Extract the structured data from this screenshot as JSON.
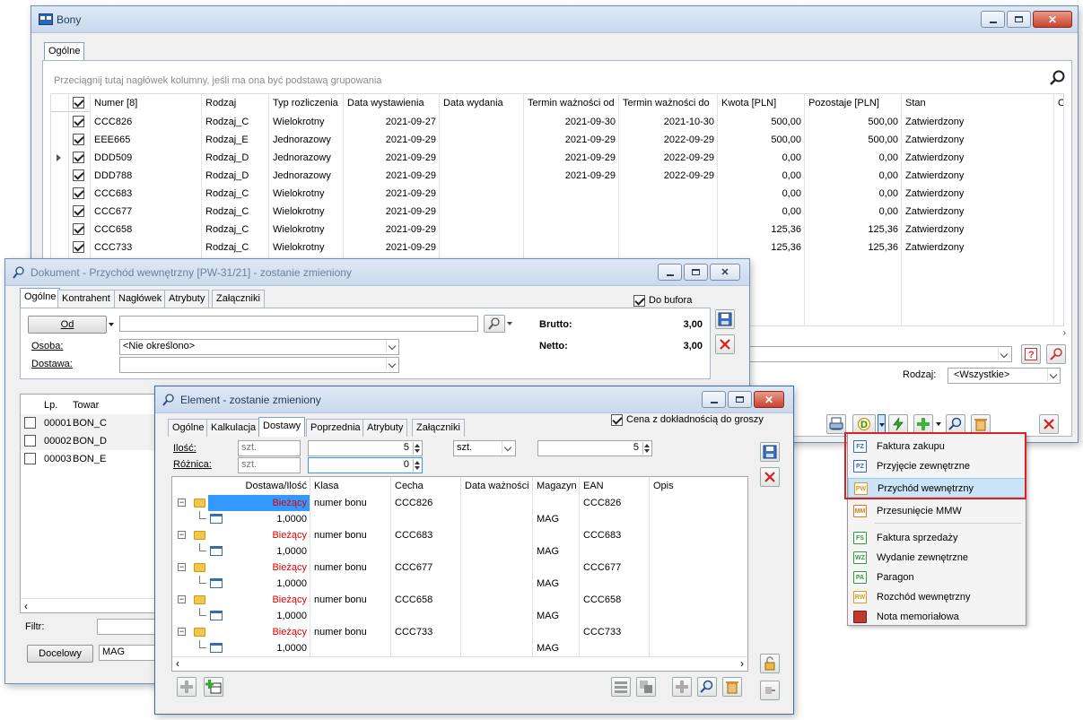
{
  "bony": {
    "title": "Bony",
    "tab_ogolne": "Ogólne",
    "group_hint": "Przeciągnij tutaj nagłówek kolumny, jeśli ma ona być podstawą grupowania",
    "columns": [
      "Numer [8]",
      "Rodzaj",
      "Typ rozliczenia",
      "Data wystawienia",
      "Data wydania",
      "Termin ważności od",
      "Termin ważności do",
      "Kwota [PLN]",
      "Pozostaje [PLN]",
      "Stan",
      "Opis"
    ],
    "rows": [
      {
        "numer": "CCC826",
        "rodzaj": "Rodzaj_C",
        "typ": "Wielokrotny",
        "data_wyst": "2021-09-27",
        "data_wyd": "",
        "od": "2021-09-30",
        "do": "2021-10-30",
        "kwota": "500,00",
        "pozostaje": "500,00",
        "stan": "Zatwierdzony"
      },
      {
        "numer": "EEE665",
        "rodzaj": "Rodzaj_E",
        "typ": "Jednorazowy",
        "data_wyst": "2021-09-29",
        "data_wyd": "",
        "od": "2021-09-29",
        "do": "2022-09-29",
        "kwota": "500,00",
        "pozostaje": "500,00",
        "stan": "Zatwierdzony"
      },
      {
        "numer": "DDD509",
        "rodzaj": "Rodzaj_D",
        "typ": "Jednorazowy",
        "data_wyst": "2021-09-29",
        "data_wyd": "",
        "od": "2021-09-29",
        "do": "2022-09-29",
        "kwota": "0,00",
        "pozostaje": "0,00",
        "stan": "Zatwierdzony"
      },
      {
        "numer": "DDD788",
        "rodzaj": "Rodzaj_D",
        "typ": "Jednorazowy",
        "data_wyst": "2021-09-29",
        "data_wyd": "",
        "od": "2021-09-29",
        "do": "2022-09-29",
        "kwota": "0,00",
        "pozostaje": "0,00",
        "stan": "Zatwierdzony"
      },
      {
        "numer": "CCC683",
        "rodzaj": "Rodzaj_C",
        "typ": "Wielokrotny",
        "data_wyst": "2021-09-29",
        "data_wyd": "",
        "od": "",
        "do": "",
        "kwota": "0,00",
        "pozostaje": "0,00",
        "stan": "Zatwierdzony"
      },
      {
        "numer": "CCC677",
        "rodzaj": "Rodzaj_C",
        "typ": "Wielokrotny",
        "data_wyst": "2021-09-29",
        "data_wyd": "",
        "od": "",
        "do": "",
        "kwota": "0,00",
        "pozostaje": "0,00",
        "stan": "Zatwierdzony"
      },
      {
        "numer": "CCC658",
        "rodzaj": "Rodzaj_C",
        "typ": "Wielokrotny",
        "data_wyst": "2021-09-29",
        "data_wyd": "",
        "od": "",
        "do": "",
        "kwota": "125,36",
        "pozostaje": "125,36",
        "stan": "Zatwierdzony"
      },
      {
        "numer": "CCC733",
        "rodzaj": "Rodzaj_C",
        "typ": "Wielokrotny",
        "data_wyst": "2021-09-29",
        "data_wyd": "",
        "od": "",
        "do": "",
        "kwota": "125,36",
        "pozostaje": "125,36",
        "stan": "Zatwierdzony"
      }
    ],
    "rodzaj_label": "Rodzaj:",
    "rodzaj_value": "<Wszystkie>"
  },
  "dokument": {
    "title": "Dokument - Przychód wewnętrzny [PW-31/21]  - zostanie zmieniony",
    "tabs": [
      "Ogólne",
      "Kontrahent",
      "Nagłówek",
      "Atrybuty",
      "Załączniki"
    ],
    "do_bufora": "Do bufora",
    "od_button": "Od",
    "osoba_label": "Osoba:",
    "osoba_value": "<Nie określono>",
    "dostawa_label": "Dostawa:",
    "brutto_label": "Brutto:",
    "brutto_value": "3,00",
    "netto_label": "Netto:",
    "netto_value": "3,00",
    "list_cols": [
      "Lp.",
      "Towar"
    ],
    "list": [
      {
        "lp": "00001",
        "towar": "BON_C"
      },
      {
        "lp": "00002",
        "towar": "BON_D"
      },
      {
        "lp": "00003",
        "towar": "BON_E"
      }
    ],
    "filtr_label": "Filtr:",
    "docelowy_button": "Docelowy",
    "mag_value": "MAG"
  },
  "element": {
    "title": "Element - zostanie zmieniony",
    "tabs": [
      "Ogólne",
      "Kalkulacja",
      "Dostawy",
      "Poprzednia",
      "Atrybuty",
      "Załączniki"
    ],
    "cena_label": "Cena z dokładnością do groszy",
    "ilosc_label": "Ilość:",
    "roznica_label": "Różnica:",
    "szt": "szt.",
    "ilosc_value": "5",
    "roznica_value": "0",
    "unit_select": "szt.",
    "ilosc_value2": "5",
    "cols": [
      "Dostawa/Ilość",
      "Klasa",
      "Cecha",
      "Data ważności",
      "Magazyn",
      "EAN",
      "Opis"
    ],
    "groups": [
      {
        "status": "Bieżący",
        "klasa": "numer bonu",
        "cecha": "CCC826",
        "ean": "CCC826",
        "qty": "1,0000",
        "magazyn": "MAG"
      },
      {
        "status": "Bieżący",
        "klasa": "numer bonu",
        "cecha": "CCC683",
        "ean": "CCC683",
        "qty": "1,0000",
        "magazyn": "MAG"
      },
      {
        "status": "Bieżący",
        "klasa": "numer bonu",
        "cecha": "CCC677",
        "ean": "CCC677",
        "qty": "1,0000",
        "magazyn": "MAG"
      },
      {
        "status": "Bieżący",
        "klasa": "numer bonu",
        "cecha": "CCC658",
        "ean": "CCC658",
        "qty": "1,0000",
        "magazyn": "MAG"
      },
      {
        "status": "Bieżący",
        "klasa": "numer bonu",
        "cecha": "CCC733",
        "ean": "CCC733",
        "qty": "1,0000",
        "magazyn": "MAG"
      }
    ]
  },
  "menu": {
    "items": [
      {
        "code": "FZ",
        "label": "Faktura zakupu",
        "color": "#2b6cc4"
      },
      {
        "code": "PZ",
        "label": "Przyjęcie zewnętrzne",
        "color": "#2b6cc4"
      },
      {
        "code": "PW",
        "label": "Przychód wewnętrzny",
        "color": "#d89a1a"
      },
      {
        "code": "MM",
        "label": "Przesunięcie MMW",
        "color": "#d87a1a"
      },
      {
        "code": "FS",
        "label": "Faktura sprzedaży",
        "color": "#2e9a3a"
      },
      {
        "code": "WZ",
        "label": "Wydanie zewnętrzne",
        "color": "#2e9a3a"
      },
      {
        "code": "PA",
        "label": "Paragon",
        "color": "#2e9a3a"
      },
      {
        "code": "RW",
        "label": "Rozchód wewnętrzny",
        "color": "#d89a1a"
      },
      {
        "code": "",
        "label": "Nota memoriałowa",
        "color": "#c0392b"
      }
    ],
    "highlight_color": "#cce4f7",
    "frame_color": "#e02020"
  },
  "colors": {
    "accent": "#3399ff",
    "status_red": "#e00000"
  }
}
